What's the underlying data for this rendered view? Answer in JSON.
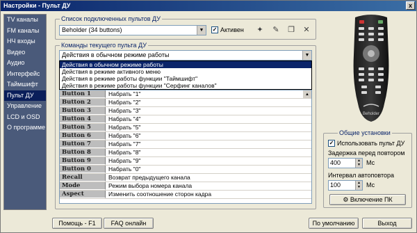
{
  "window": {
    "title": "Настройки - Пульт ДУ",
    "close_glyph": "x"
  },
  "sidebar": {
    "items": [
      {
        "label": "TV каналы"
      },
      {
        "label": "FM каналы"
      },
      {
        "label": "НЧ входы"
      },
      {
        "label": "Видео"
      },
      {
        "label": "Аудио"
      },
      {
        "label": "Интерфейс"
      },
      {
        "label": "Таймшифт"
      },
      {
        "label": "Пульт ДУ",
        "active": true
      },
      {
        "label": "Управление"
      },
      {
        "label": "LCD и OSD"
      },
      {
        "label": "О программе"
      }
    ]
  },
  "remotes": {
    "legend": "Список подключенных пультов ДУ",
    "selected": "Beholder (34 buttons)",
    "active_label": "Активен",
    "active_checked": true,
    "check_glyph": "✓",
    "icons": [
      "new-icon",
      "edit-icon",
      "copy-icon",
      "delete-icon"
    ]
  },
  "commands": {
    "legend": "Команды текущего пульта ДУ",
    "selected_mode": "Действия в обычном режиме работы",
    "mode_options": [
      "Действия в обычном режиме работы",
      "Действия в режиме активного меню",
      "Действия в режиме работы функции \"Таймшифт\"",
      "Действия в режиме работы функции \"Серфинг каналов\""
    ],
    "rows": [
      {
        "key": "Button 1",
        "action": "Набрать \"1\""
      },
      {
        "key": "Button 2",
        "action": "Набрать \"2\""
      },
      {
        "key": "Button 3",
        "action": "Набрать \"3\""
      },
      {
        "key": "Button 4",
        "action": "Набрать \"4\""
      },
      {
        "key": "Button 5",
        "action": "Набрать \"5\""
      },
      {
        "key": "Button 6",
        "action": "Набрать \"6\""
      },
      {
        "key": "Button 7",
        "action": "Набрать \"7\""
      },
      {
        "key": "Button 8",
        "action": "Набрать \"8\""
      },
      {
        "key": "Button 9",
        "action": "Набрать \"9\""
      },
      {
        "key": "Button 0",
        "action": "Набрать \"0\""
      },
      {
        "key": "Recall",
        "action": "Возврат предыдущего канала"
      },
      {
        "key": "Mode",
        "action": "Режим выбора номера канала"
      },
      {
        "key": "Aspect",
        "action": "Изменить соотношение сторон кадра"
      }
    ]
  },
  "general": {
    "legend": "Общие установки",
    "use_remote_label": "Использовать пульт ДУ",
    "use_remote_checked": true,
    "delay_label": "Задержка перед повтором",
    "delay_value": "400",
    "interval_label": "Интервал автоповтора",
    "interval_value": "100",
    "unit": "Мс",
    "power_on_label": "Включение ПК"
  },
  "footer": {
    "help": "Помощь - F1",
    "faq": "FAQ онлайн",
    "defaults": "По умолчанию",
    "exit": "Выход"
  },
  "remote_image": {
    "brand": "Beholder"
  }
}
